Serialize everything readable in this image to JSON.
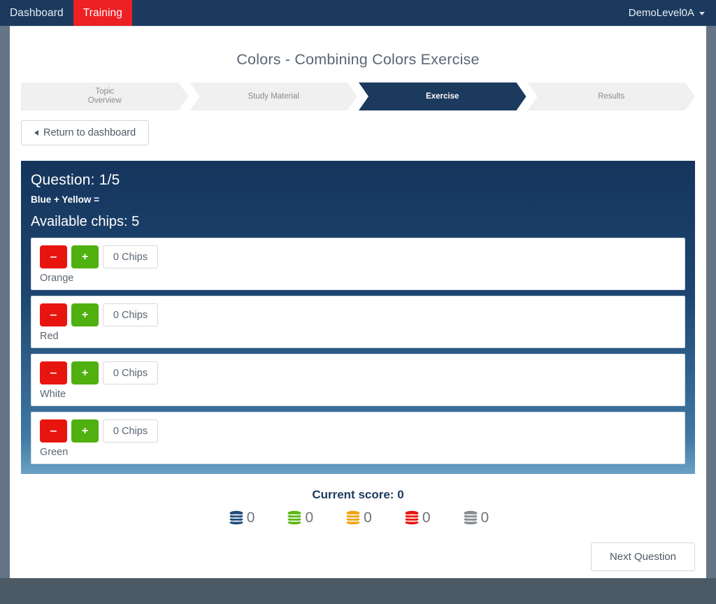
{
  "navbar": {
    "items": [
      {
        "label": "Dashboard",
        "active": false
      },
      {
        "label": "Training",
        "active": true
      }
    ],
    "user": "DemoLevel0A",
    "caret_icon": "chevron-down-icon"
  },
  "page": {
    "title": "Colors - Combining Colors Exercise"
  },
  "steps": [
    {
      "label": "Topic\nOverview",
      "active": false
    },
    {
      "label": "Study Material",
      "active": false
    },
    {
      "label": "Exercise",
      "active": true
    },
    {
      "label": "Results",
      "active": false
    }
  ],
  "return_button": {
    "label": "Return to dashboard",
    "icon": "chevron-left-icon"
  },
  "question": {
    "heading": "Question: 1/5",
    "formula": "Blue + Yellow =",
    "available": "Available chips: 5"
  },
  "chip_rows": [
    {
      "label": "Orange",
      "count": "0 Chips",
      "minus": "‒",
      "plus": "+"
    },
    {
      "label": "Red",
      "count": "0 Chips",
      "minus": "‒",
      "plus": "+"
    },
    {
      "label": "White",
      "count": "0 Chips",
      "minus": "‒",
      "plus": "+"
    },
    {
      "label": "Green",
      "count": "0 Chips",
      "minus": "‒",
      "plus": "+"
    }
  ],
  "score": {
    "title": "Current score: 0",
    "chips": [
      {
        "name": "blue",
        "color": "#1f4e79",
        "value": "0"
      },
      {
        "name": "green",
        "color": "#5cb811",
        "value": "0"
      },
      {
        "name": "orange",
        "color": "#f5a20c",
        "value": "0"
      },
      {
        "name": "red",
        "color": "#e8150f",
        "value": "0"
      },
      {
        "name": "grey",
        "color": "#878d92",
        "value": "0"
      }
    ]
  },
  "next_button": {
    "label": "Next Question"
  },
  "colors": {
    "navy": "#1b3a5e",
    "red_accent": "#ed2024",
    "panel_top": "#15355c",
    "panel_bottom": "#6aa0c4",
    "frame_grey": "#667585",
    "footer": "#4c5a66"
  }
}
